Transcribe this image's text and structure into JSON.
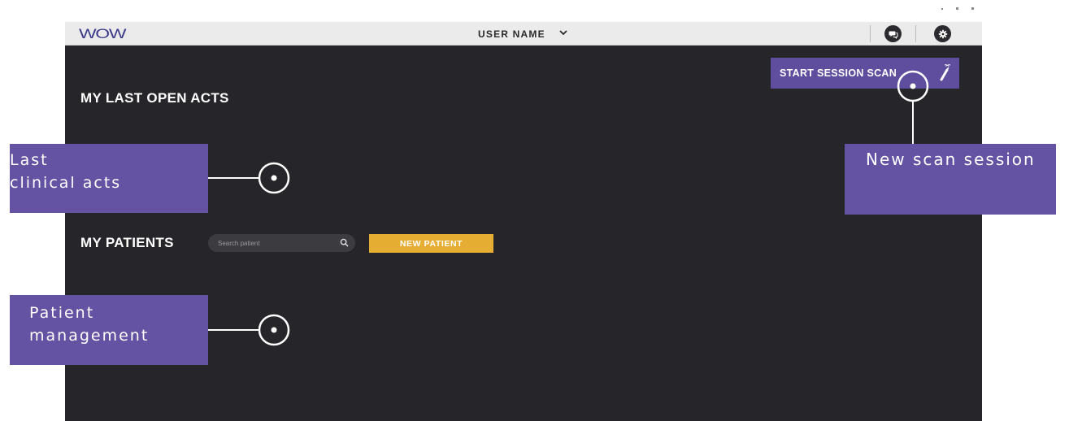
{
  "window": {},
  "topbar": {
    "logo": "WOW",
    "user_name": "USER NAME",
    "icons": [
      "chat-icon",
      "gear-icon",
      "chevron-down-icon"
    ]
  },
  "main": {
    "last_acts_title": "MY LAST OPEN ACTS",
    "start_scan_label": "START SESSION SCAN",
    "patients_title": "MY PATIENTS",
    "search_placeholder": "Search patient",
    "new_patient_label": "NEW PATIENT"
  },
  "callouts": {
    "last_acts": {
      "line1": "Last",
      "line2": "clinical acts"
    },
    "scan": {
      "text": "New scan session"
    },
    "patients": {
      "line1": "Patient",
      "line2": "management"
    }
  },
  "colors": {
    "app_background": "#26262a",
    "topbar": "#ebebeb",
    "accent_purple": "#5f4d9e",
    "callout_purple": "#6452a2",
    "new_patient_yellow": "#e5ae32"
  }
}
